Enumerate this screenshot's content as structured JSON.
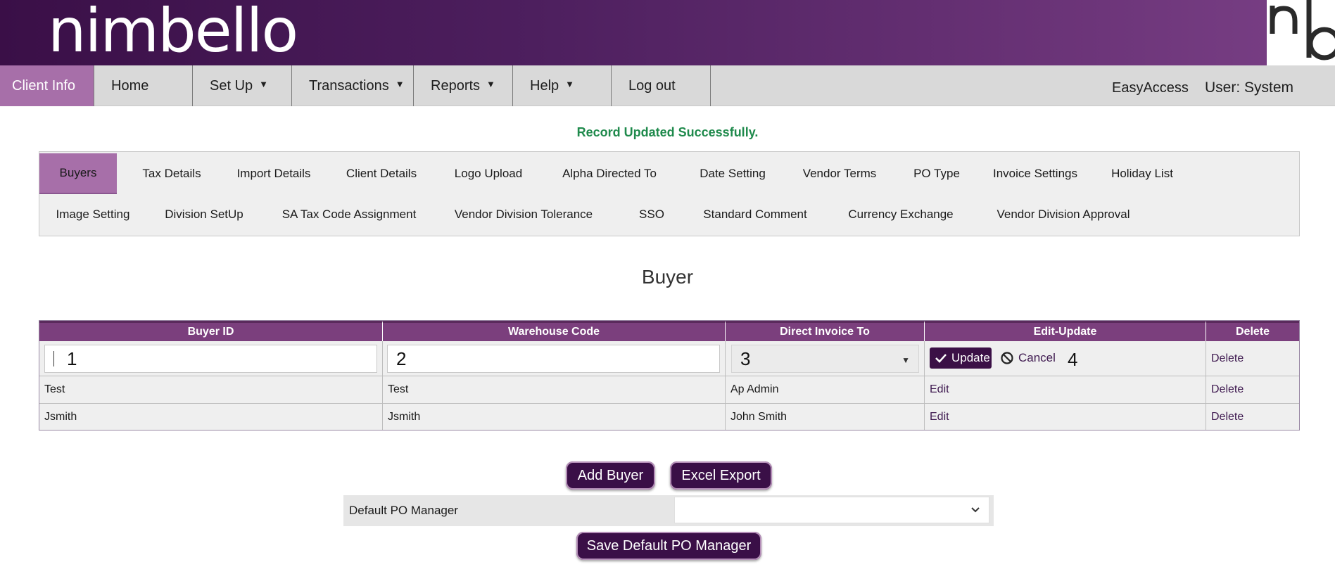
{
  "header": {
    "logo_text": "nimbello"
  },
  "nav": {
    "items": [
      {
        "label": "Client Info"
      },
      {
        "label": "Home"
      },
      {
        "label": "Set Up"
      },
      {
        "label": "Transactions"
      },
      {
        "label": "Reports"
      },
      {
        "label": "Help"
      },
      {
        "label": "Log out"
      }
    ],
    "caret": "▼",
    "easy_access": "EasyAccess",
    "user": "User: System"
  },
  "message": "Record Updated Successfully.",
  "tabs": {
    "row1": [
      "Buyers",
      "Tax Details",
      "Import Details",
      "Client Details",
      "Logo Upload",
      "Alpha Directed To",
      "Date Setting",
      "Vendor Terms",
      "PO Type",
      "Invoice Settings",
      "Holiday List"
    ],
    "row2": [
      "Image Setting",
      "Division SetUp",
      "SA Tax Code Assignment",
      "Vendor Division Tolerance",
      "SSO",
      "Standard Comment",
      "Currency Exchange",
      "Vendor Division Approval"
    ],
    "active": "Buyers"
  },
  "section_title": "Buyer",
  "grid": {
    "headers": [
      "Buyer ID",
      "Warehouse Code",
      "Direct Invoice To",
      "Edit-Update",
      "Delete"
    ],
    "edit_row": {
      "buyer_id": "1",
      "warehouse_code": "2",
      "direct_invoice_to": "3",
      "marker": "4",
      "update_label": "Update",
      "cancel_label": "Cancel",
      "delete_label": "Delete"
    },
    "rows": [
      {
        "buyer_id": "Test",
        "warehouse_code": "Test",
        "direct_invoice_to": "Ap Admin",
        "edit": "Edit",
        "delete": "Delete"
      },
      {
        "buyer_id": "Jsmith",
        "warehouse_code": "Jsmith",
        "direct_invoice_to": "John Smith",
        "edit": "Edit",
        "delete": "Delete"
      }
    ]
  },
  "buttons": {
    "add_buyer": "Add Buyer",
    "excel_export": "Excel Export",
    "save_default": "Save Default PO Manager"
  },
  "po_manager": {
    "label": "Default PO Manager",
    "value": ""
  },
  "colors": {
    "brand": "#3a0f47",
    "accent": "#a76fa9",
    "header_row": "#7b3f7d",
    "success": "#1f8a4c"
  }
}
